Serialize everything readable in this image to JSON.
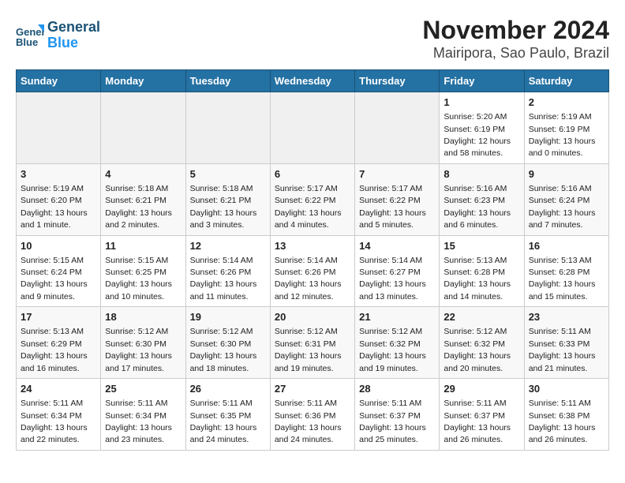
{
  "logo": {
    "line1": "General",
    "line2": "Blue"
  },
  "title": "November 2024",
  "subtitle": "Mairipora, Sao Paulo, Brazil",
  "weekdays": [
    "Sunday",
    "Monday",
    "Tuesday",
    "Wednesday",
    "Thursday",
    "Friday",
    "Saturday"
  ],
  "weeks": [
    [
      {
        "day": "",
        "info": ""
      },
      {
        "day": "",
        "info": ""
      },
      {
        "day": "",
        "info": ""
      },
      {
        "day": "",
        "info": ""
      },
      {
        "day": "",
        "info": ""
      },
      {
        "day": "1",
        "info": "Sunrise: 5:20 AM\nSunset: 6:19 PM\nDaylight: 12 hours\nand 58 minutes."
      },
      {
        "day": "2",
        "info": "Sunrise: 5:19 AM\nSunset: 6:19 PM\nDaylight: 13 hours\nand 0 minutes."
      }
    ],
    [
      {
        "day": "3",
        "info": "Sunrise: 5:19 AM\nSunset: 6:20 PM\nDaylight: 13 hours\nand 1 minute."
      },
      {
        "day": "4",
        "info": "Sunrise: 5:18 AM\nSunset: 6:21 PM\nDaylight: 13 hours\nand 2 minutes."
      },
      {
        "day": "5",
        "info": "Sunrise: 5:18 AM\nSunset: 6:21 PM\nDaylight: 13 hours\nand 3 minutes."
      },
      {
        "day": "6",
        "info": "Sunrise: 5:17 AM\nSunset: 6:22 PM\nDaylight: 13 hours\nand 4 minutes."
      },
      {
        "day": "7",
        "info": "Sunrise: 5:17 AM\nSunset: 6:22 PM\nDaylight: 13 hours\nand 5 minutes."
      },
      {
        "day": "8",
        "info": "Sunrise: 5:16 AM\nSunset: 6:23 PM\nDaylight: 13 hours\nand 6 minutes."
      },
      {
        "day": "9",
        "info": "Sunrise: 5:16 AM\nSunset: 6:24 PM\nDaylight: 13 hours\nand 7 minutes."
      }
    ],
    [
      {
        "day": "10",
        "info": "Sunrise: 5:15 AM\nSunset: 6:24 PM\nDaylight: 13 hours\nand 9 minutes."
      },
      {
        "day": "11",
        "info": "Sunrise: 5:15 AM\nSunset: 6:25 PM\nDaylight: 13 hours\nand 10 minutes."
      },
      {
        "day": "12",
        "info": "Sunrise: 5:14 AM\nSunset: 6:26 PM\nDaylight: 13 hours\nand 11 minutes."
      },
      {
        "day": "13",
        "info": "Sunrise: 5:14 AM\nSunset: 6:26 PM\nDaylight: 13 hours\nand 12 minutes."
      },
      {
        "day": "14",
        "info": "Sunrise: 5:14 AM\nSunset: 6:27 PM\nDaylight: 13 hours\nand 13 minutes."
      },
      {
        "day": "15",
        "info": "Sunrise: 5:13 AM\nSunset: 6:28 PM\nDaylight: 13 hours\nand 14 minutes."
      },
      {
        "day": "16",
        "info": "Sunrise: 5:13 AM\nSunset: 6:28 PM\nDaylight: 13 hours\nand 15 minutes."
      }
    ],
    [
      {
        "day": "17",
        "info": "Sunrise: 5:13 AM\nSunset: 6:29 PM\nDaylight: 13 hours\nand 16 minutes."
      },
      {
        "day": "18",
        "info": "Sunrise: 5:12 AM\nSunset: 6:30 PM\nDaylight: 13 hours\nand 17 minutes."
      },
      {
        "day": "19",
        "info": "Sunrise: 5:12 AM\nSunset: 6:30 PM\nDaylight: 13 hours\nand 18 minutes."
      },
      {
        "day": "20",
        "info": "Sunrise: 5:12 AM\nSunset: 6:31 PM\nDaylight: 13 hours\nand 19 minutes."
      },
      {
        "day": "21",
        "info": "Sunrise: 5:12 AM\nSunset: 6:32 PM\nDaylight: 13 hours\nand 19 minutes."
      },
      {
        "day": "22",
        "info": "Sunrise: 5:12 AM\nSunset: 6:32 PM\nDaylight: 13 hours\nand 20 minutes."
      },
      {
        "day": "23",
        "info": "Sunrise: 5:11 AM\nSunset: 6:33 PM\nDaylight: 13 hours\nand 21 minutes."
      }
    ],
    [
      {
        "day": "24",
        "info": "Sunrise: 5:11 AM\nSunset: 6:34 PM\nDaylight: 13 hours\nand 22 minutes."
      },
      {
        "day": "25",
        "info": "Sunrise: 5:11 AM\nSunset: 6:34 PM\nDaylight: 13 hours\nand 23 minutes."
      },
      {
        "day": "26",
        "info": "Sunrise: 5:11 AM\nSunset: 6:35 PM\nDaylight: 13 hours\nand 24 minutes."
      },
      {
        "day": "27",
        "info": "Sunrise: 5:11 AM\nSunset: 6:36 PM\nDaylight: 13 hours\nand 24 minutes."
      },
      {
        "day": "28",
        "info": "Sunrise: 5:11 AM\nSunset: 6:37 PM\nDaylight: 13 hours\nand 25 minutes."
      },
      {
        "day": "29",
        "info": "Sunrise: 5:11 AM\nSunset: 6:37 PM\nDaylight: 13 hours\nand 26 minutes."
      },
      {
        "day": "30",
        "info": "Sunrise: 5:11 AM\nSunset: 6:38 PM\nDaylight: 13 hours\nand 26 minutes."
      }
    ]
  ]
}
